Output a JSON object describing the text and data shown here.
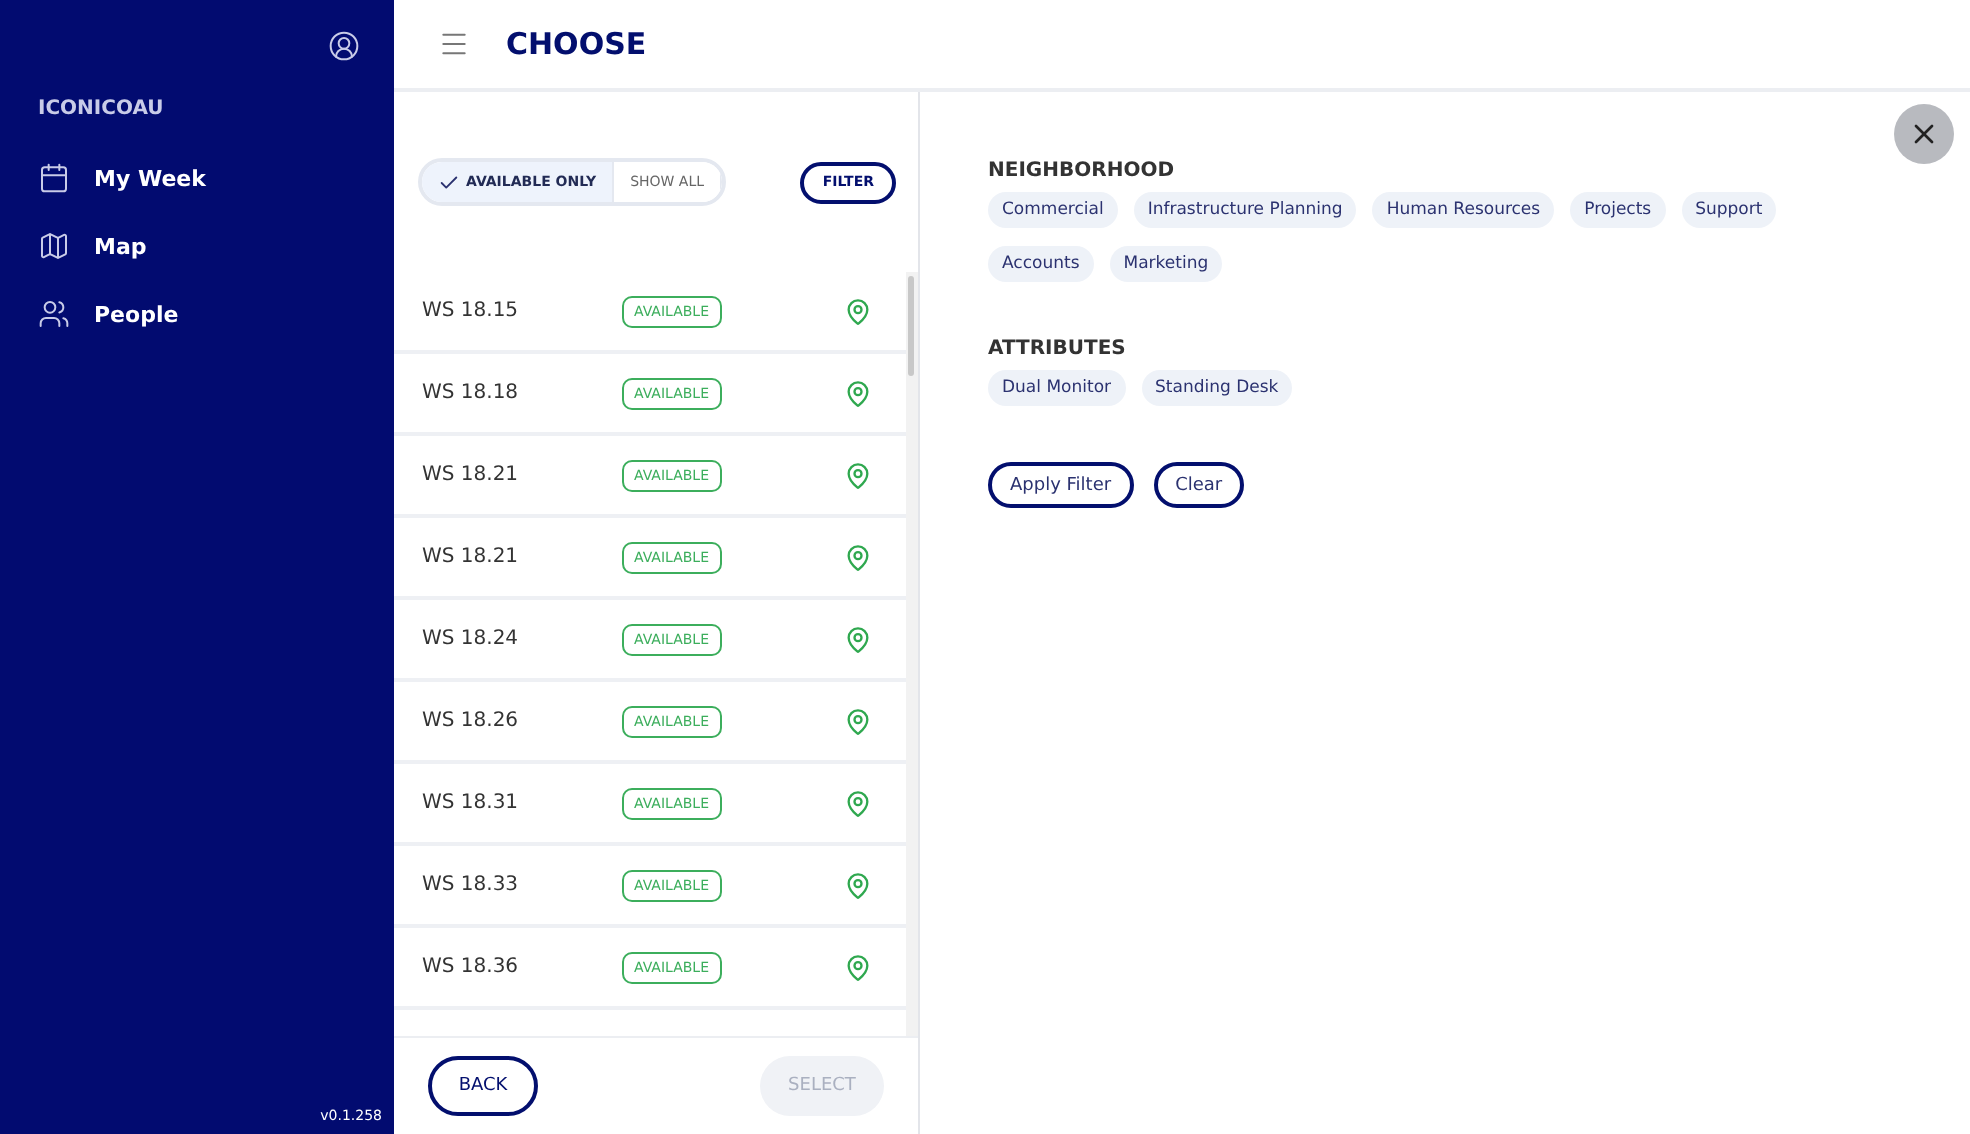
{
  "sidebar": {
    "brand": "ICONICOAU",
    "items": [
      {
        "label": "My Week",
        "kind": "calendar"
      },
      {
        "label": "Map",
        "kind": "map"
      },
      {
        "label": "People",
        "kind": "people"
      }
    ],
    "version": "v0.1.258"
  },
  "header": {
    "title": "CHOOSE"
  },
  "toggle": [
    {
      "label": "AVAILABLE ONLY",
      "selected": true
    },
    {
      "label": "SHOW ALL",
      "selected": false
    }
  ],
  "filter_button": "FILTER",
  "desks": [
    {
      "name": "WS 18.15",
      "status": "AVAILABLE"
    },
    {
      "name": "WS 18.18",
      "status": "AVAILABLE"
    },
    {
      "name": "WS 18.21",
      "status": "AVAILABLE"
    },
    {
      "name": "WS 18.21",
      "status": "AVAILABLE"
    },
    {
      "name": "WS 18.24",
      "status": "AVAILABLE"
    },
    {
      "name": "WS 18.26",
      "status": "AVAILABLE"
    },
    {
      "name": "WS 18.31",
      "status": "AVAILABLE"
    },
    {
      "name": "WS 18.33",
      "status": "AVAILABLE"
    },
    {
      "name": "WS 18.36",
      "status": "AVAILABLE"
    }
  ],
  "footer": {
    "back": "BACK",
    "select": {
      "label": "SELECT",
      "disabled": true
    }
  },
  "filters": {
    "sections": [
      {
        "title": "NEIGHBORHOOD",
        "chips": [
          {
            "label": "Commercial",
            "selected": false
          },
          {
            "label": "Infrastructure Planning",
            "selected": false
          },
          {
            "label": "Human Resources",
            "selected": false
          },
          {
            "label": "Projects",
            "selected": false
          },
          {
            "label": "Support",
            "selected": false
          },
          {
            "label": "Accounts",
            "selected": false
          },
          {
            "label": "Marketing",
            "selected": false
          }
        ]
      },
      {
        "title": "ATTRIBUTES",
        "chips": [
          {
            "label": "Dual Monitor",
            "selected": false
          },
          {
            "label": "Standing Desk",
            "selected": false
          }
        ]
      }
    ],
    "actions": [
      "Apply Filter",
      "Clear"
    ]
  }
}
